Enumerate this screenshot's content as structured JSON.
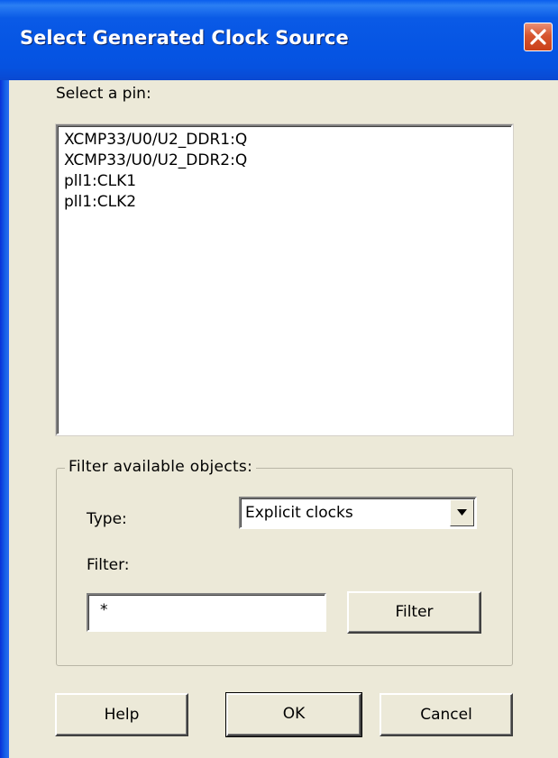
{
  "window": {
    "title": "Select Generated Clock Source",
    "title_bar_color": "#0554e3",
    "close_button_color": "#d7552f"
  },
  "pin_select": {
    "label": "Select a pin:",
    "items": [
      "XCMP33/U0/U2_DDR1:Q",
      "XCMP33/U0/U2_DDR2:Q",
      "pll1:CLK1",
      "pll1:CLK2"
    ]
  },
  "filter_group": {
    "legend": "Filter available objects:",
    "type_label": "Type:",
    "type_value": "Explicit clocks",
    "filter_label": "Filter:",
    "filter_value": "*",
    "filter_button": "Filter"
  },
  "buttons": {
    "help": "Help",
    "ok": "OK",
    "cancel": "Cancel"
  },
  "icons": {
    "close": "close-icon",
    "dropdown": "chevron-down-icon"
  }
}
